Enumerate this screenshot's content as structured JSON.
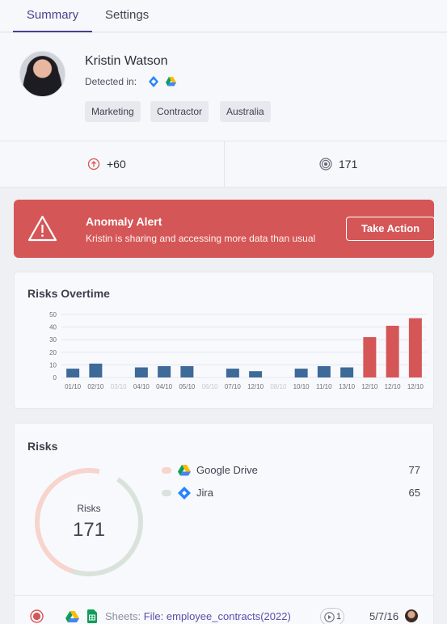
{
  "tabs": {
    "summary": "Summary",
    "settings": "Settings"
  },
  "profile": {
    "name": "Kristin Watson",
    "detected_label": "Detected in:",
    "detected_sources": [
      "jira-icon",
      "google-drive-icon"
    ],
    "tags": [
      "Marketing",
      "Contractor",
      "Australia"
    ]
  },
  "stats": {
    "risk_change": "+60",
    "risk_total": "171"
  },
  "alert": {
    "title": "Anomaly Alert",
    "description": "Kristin is sharing and accessing more data than usual",
    "action": "Take Action",
    "color": "#d55657"
  },
  "risks_overtime": {
    "title": "Risks Overtime"
  },
  "chart_data": {
    "type": "bar",
    "title": "Risks Overtime",
    "categories": [
      "01/10",
      "02/10",
      "03/10",
      "04/10",
      "04/10",
      "05/10",
      "06/10",
      "07/10",
      "12/10",
      "08/10",
      "10/10",
      "11/10",
      "13/10",
      "12/10",
      "12/10",
      "12/10"
    ],
    "values": [
      7,
      11,
      0,
      8,
      9,
      9,
      0,
      7,
      5,
      0,
      7,
      9,
      8,
      32,
      41,
      47
    ],
    "highlight": [
      false,
      false,
      false,
      false,
      false,
      false,
      false,
      false,
      false,
      false,
      false,
      false,
      false,
      true,
      true,
      true
    ],
    "muted_categories": [
      2,
      6,
      9
    ],
    "yticks": [
      0,
      10,
      20,
      30,
      40,
      50
    ],
    "ylim": [
      0,
      50
    ],
    "colors": {
      "normal": "#3d6a99",
      "highlight": "#d55657"
    },
    "grid": true
  },
  "risks": {
    "title": "Risks",
    "donut_label": "Risks",
    "total": "171",
    "sources": [
      {
        "name": "Google Drive",
        "value": "77",
        "icon": "google-drive-icon",
        "color": "#f7d4cd"
      },
      {
        "name": "Jira",
        "value": "65",
        "icon": "jira-icon",
        "color": "#d9e3dc"
      }
    ]
  },
  "activity": {
    "prefix": "Sheets:",
    "file": "File: employee_contracts(2022)",
    "views": "1",
    "date": "5/7/16"
  }
}
